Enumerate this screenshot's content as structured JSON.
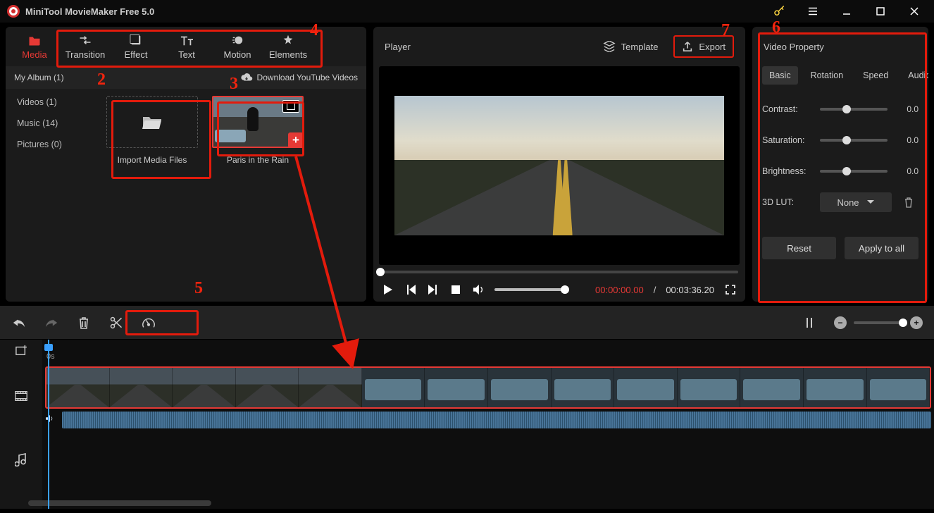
{
  "titlebar": {
    "appTitle": "MiniTool MovieMaker Free 5.0"
  },
  "modes": {
    "media": "Media",
    "transition": "Transition",
    "effect": "Effect",
    "text": "Text",
    "motion": "Motion",
    "elements": "Elements"
  },
  "leftPanel": {
    "albumLabel": "My Album (1)",
    "downloadYT": "Download YouTube Videos",
    "sidebar": {
      "videos": "Videos (1)",
      "music": "Music (14)",
      "pictures": "Pictures (0)"
    },
    "importLabel": "Import Media Files",
    "clip1Label": "Paris in the Rain"
  },
  "player": {
    "title": "Player",
    "template": "Template",
    "export": "Export",
    "currentTime": "00:00:00.00",
    "sep": " / ",
    "duration": "00:03:36.20"
  },
  "props": {
    "title": "Video Property",
    "tabs": {
      "basic": "Basic",
      "rotation": "Rotation",
      "speed": "Speed",
      "audio": "Audio"
    },
    "contrast": {
      "label": "Contrast:",
      "value": "0.0"
    },
    "saturation": {
      "label": "Saturation:",
      "value": "0.0"
    },
    "brightness": {
      "label": "Brightness:",
      "value": "0.0"
    },
    "lut": {
      "label": "3D LUT:",
      "value": "None"
    },
    "reset": "Reset",
    "applyAll": "Apply to all"
  },
  "timeline": {
    "rulerStart": "0s"
  },
  "annotations": {
    "n2": "2",
    "n3": "3",
    "n4": "4",
    "n5": "5",
    "n6": "6",
    "n7": "7"
  }
}
